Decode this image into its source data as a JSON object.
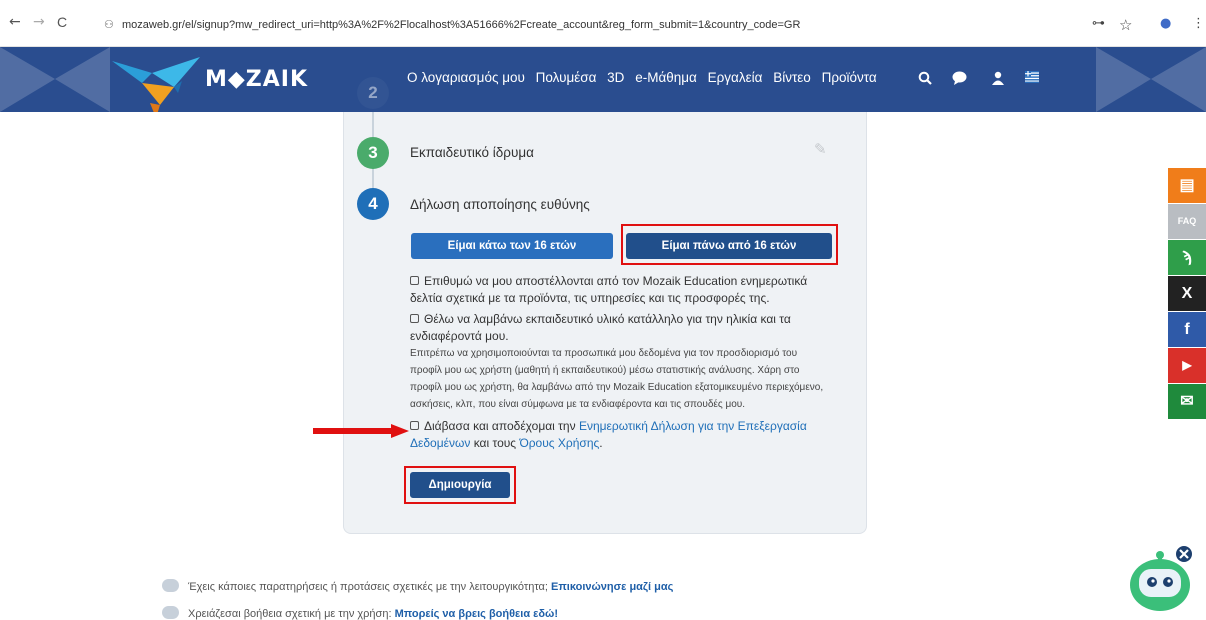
{
  "browser": {
    "url": "mozaweb.gr/el/signup?mw_redirect_uri=http%3A%2F%2Flocalhost%3A51666%2Fcreate_account&reg_form_submit=1&country_code=GR",
    "back": "←",
    "forward": "→",
    "reload": "C",
    "tune": "⚇",
    "key": "⊶",
    "star": "☆",
    "profile": "●",
    "more": "⋮"
  },
  "brand": {
    "logo_text": "M◆ZAIK",
    "primary_color": "#2a4d8f"
  },
  "menu": {
    "items": [
      "Ο λογαριασμός μου",
      "Πολυμέσα",
      "3D",
      "e-Μάθημα",
      "Εργαλεία",
      "Βίντεο",
      "Προϊόντα"
    ],
    "search_icon": "🔍",
    "chat_icon": "💬",
    "user_icon": "👤",
    "flag_icon": "☰"
  },
  "steps": {
    "step2_number": "2",
    "step3_number": "3",
    "step3_title": "Εκπαιδευτικό ίδρυμα",
    "step3_edit_icon": "✎",
    "step4_number": "4",
    "step4_title": "Δήλωση αποποίησης ευθύνης",
    "step3_color": "#4aab6b",
    "step4_color": "#1f6fb8"
  },
  "age": {
    "under16": "Είμαι κάτω των 16 ετών",
    "over16": "Είμαι πάνω από 16 ετών"
  },
  "consents": {
    "newsletter": "Επιθυμώ να μου αποστέλλονται από τον Mozaik Education ενημερωτικά δελτία σχετικά με τα προϊόντα, τις υπηρεσίες και τις προσφορές της.",
    "material_line1": "Θέλω να λαμβάνω εκπαιδευτικό υλικό κατάλληλο για την ηλικία και τα",
    "material_line2": "ενδιαφέροντά μου.",
    "explanation": "Επιτρέπω να χρησιμοποιούνται τα προσωπικά μου δεδομένα για τον προσδιορισμό του προφίλ μου ως χρήστη (μαθητή ή εκπαιδευτικού) μέσω στατιστικής ανάλυσης. Χάρη στο προφίλ μου ως χρήστη, θα λαμβάνω από την Mozaik Education εξατομικευμένο περιεχόμενο, ασκήσεις, κλπ, που είναι σύμφωνα με τα ενδιαφέροντα και τις σπουδές μου.",
    "terms_prefix": "Διάβασα και αποδέχομαι την",
    "terms_link1": "Ενημερωτική Δήλωση για την Επεξεργασία Δεδομένων",
    "terms_middle": "και τους",
    "terms_link2": "Όρους Χρήσης",
    "terms_suffix": "."
  },
  "submit_label": "Δημιουργία",
  "social": {
    "items": [
      {
        "name": "comment",
        "glyph": "▤",
        "color": "#f07d1a"
      },
      {
        "name": "faq",
        "glyph": "FAQ",
        "color": "#b9bdc2"
      },
      {
        "name": "rss",
        "glyph": "ϡ",
        "color": "#2f9e4a"
      },
      {
        "name": "x",
        "glyph": "X",
        "color": "#222222"
      },
      {
        "name": "facebook",
        "glyph": "f",
        "color": "#2f5aa8"
      },
      {
        "name": "youtube",
        "glyph": "▶",
        "color": "#d9302a"
      },
      {
        "name": "email",
        "glyph": "✉",
        "color": "#1f8a3c"
      }
    ]
  },
  "footer": {
    "line1_text": "Έχεις κάποιες παρατηρήσεις ή προτάσεις σχετικές με την λειτουργικότητα;",
    "line1_link": "Επικοινώνησε μαζί μας",
    "line2_text": "Χρειάζεσαι βοήθεια σχετική με την χρήση:",
    "line2_link": "Μπορείς να βρεις βοήθεια εδώ!"
  }
}
